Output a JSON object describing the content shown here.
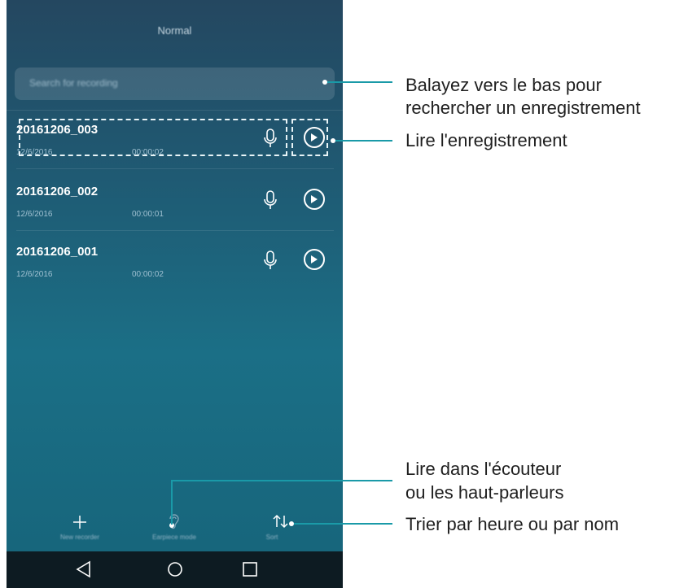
{
  "header": {
    "title": "Normal"
  },
  "search": {
    "placeholder": "Search for recording"
  },
  "recordings": [
    {
      "name": "20161206_003",
      "date": "12/6/2016",
      "duration": "00:00:02"
    },
    {
      "name": "20161206_002",
      "date": "12/6/2016",
      "duration": "00:00:01"
    },
    {
      "name": "20161206_001",
      "date": "12/6/2016",
      "duration": "00:00:02"
    }
  ],
  "bottom_bar": {
    "new_label": "New recorder",
    "earpiece_label": "Earpiece mode",
    "sort_label": "Sort"
  },
  "callouts": {
    "search_line1": "Balayez vers le bas pour",
    "search_line2": "rechercher un enregistrement",
    "play": "Lire l'enregistrement",
    "earpiece_line1": "Lire dans l'écouteur",
    "earpiece_line2": "ou les haut-parleurs",
    "sort": "Trier par heure ou par nom"
  },
  "colors": {
    "accent_callout": "#1a9aa8",
    "background_top": "#244760",
    "background_bottom": "#16647a"
  }
}
